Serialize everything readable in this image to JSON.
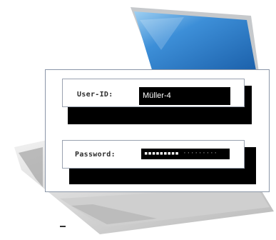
{
  "login": {
    "user_label": "User-ID:",
    "user_value": "Müller-4",
    "password_label": "Password:",
    "password_mask": "▪▪▪▪▪▪▪▪▪",
    "password_mask_dim": "·········"
  },
  "icons": {
    "background": "laptop-icon"
  },
  "colors": {
    "screen_blue": "#2a79c9",
    "card_border": "#8a96a8",
    "field_fill": "#000000",
    "field_text": "#ffffff"
  }
}
